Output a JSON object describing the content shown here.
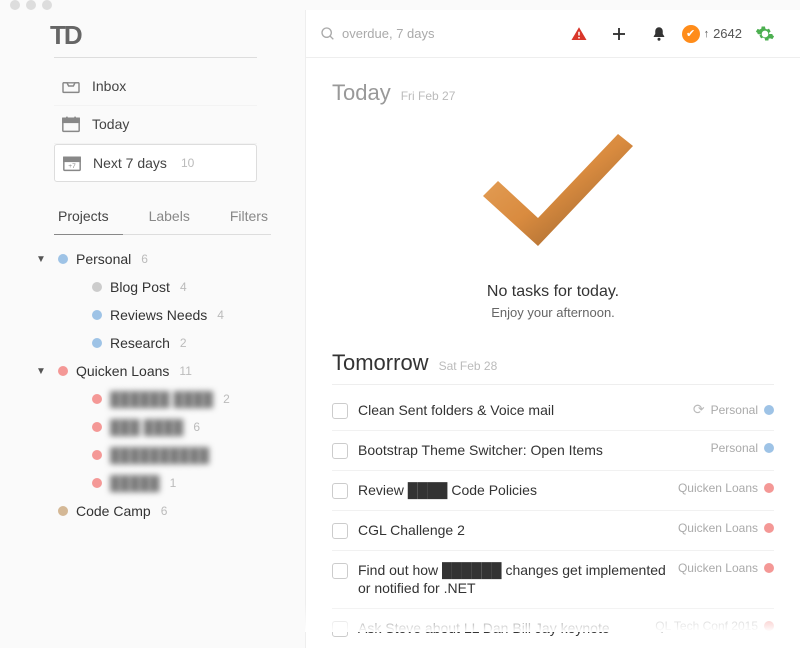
{
  "logo": "TD",
  "sidebar": {
    "views": [
      {
        "label": "Inbox",
        "count": ""
      },
      {
        "label": "Today",
        "count": ""
      },
      {
        "label": "Next 7 days",
        "count": "10"
      }
    ],
    "tabs": [
      "Projects",
      "Labels",
      "Filters"
    ],
    "projects": [
      {
        "name": "Personal",
        "count": "6",
        "color": "#9ec3e6",
        "expanded": true,
        "children": [
          {
            "name": "Blog Post",
            "count": "4",
            "color": "#ccc"
          },
          {
            "name": "Reviews Needs",
            "count": "4",
            "color": "#9ec3e6"
          },
          {
            "name": "Research",
            "count": "2",
            "color": "#9ec3e6"
          }
        ]
      },
      {
        "name": "Quicken Loans",
        "count": "11",
        "color": "#f49896",
        "expanded": true,
        "children": [
          {
            "name": "██████ ████",
            "count": "2",
            "color": "#f49896",
            "blur": true
          },
          {
            "name": "███ ████",
            "count": "6",
            "color": "#f49896",
            "blur": true
          },
          {
            "name": "██████████",
            "count": "",
            "color": "#f49896",
            "blur": true
          },
          {
            "name": "█████",
            "count": "1",
            "color": "#f49896",
            "blur": true
          }
        ]
      },
      {
        "name": "Code Camp",
        "count": "6",
        "color": "#d4b896",
        "expanded": false,
        "children": []
      }
    ]
  },
  "toolbar": {
    "search_placeholder": "overdue, 7 days",
    "karma": "2642"
  },
  "sections": [
    {
      "title": "Today",
      "sub": "Fri Feb 27",
      "empty": true,
      "empty_msg1": "No tasks for today.",
      "empty_msg2": "Enjoy your afternoon."
    },
    {
      "title": "Tomorrow",
      "sub": "Sat Feb 28",
      "tasks": [
        {
          "text": "Clean Sent folders & Voice mail",
          "project": "Personal",
          "dot": "#9ec3e6",
          "recurring": true
        },
        {
          "text": "Bootstrap Theme Switcher: Open Items",
          "project": "Personal",
          "dot": "#9ec3e6"
        },
        {
          "text": "Review ████ Code Policies",
          "project": "Quicken Loans",
          "dot": "#f49896"
        },
        {
          "text": "CGL Challenge 2",
          "project": "Quicken Loans",
          "dot": "#f49896"
        },
        {
          "text": "Find out how ██████ changes get implemented or notified for .NET",
          "project": "Quicken Loans",
          "dot": "#f49896"
        },
        {
          "text": "Ask Steve about LL  Dan  Bill  Jay keynote",
          "project": "QL Tech Conf 2015",
          "dot": "#f49896"
        }
      ]
    }
  ]
}
